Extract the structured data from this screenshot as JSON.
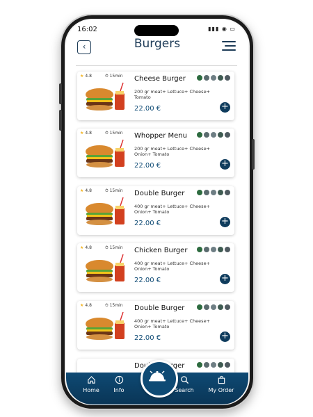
{
  "status": {
    "time": "16:02",
    "icons": "▮▮▮ ◉ ▭"
  },
  "header": {
    "back_icon": "back-arrow-icon",
    "back_glyph": "‹",
    "title": "Burgers",
    "menu_icon": "hamburger-menu-icon"
  },
  "items": [
    {
      "rating": "4.8",
      "time": "15min",
      "name": "Cheese Burger",
      "description": "200 gr meat+ Lettuce+ Cheese+ Tomato",
      "price": "22.00 €"
    },
    {
      "rating": "4.8",
      "time": "15min",
      "name": "Whopper Menu",
      "description": "200 gr meat+ Lettuce+ Cheese+ Onion+ Tomato",
      "price": "22.00 €"
    },
    {
      "rating": "4.8",
      "time": "15min",
      "name": "Double Burger",
      "description": "400 gr meat+ Lettuce+ Cheese+ Onion+ Tomato",
      "price": "22.00 €"
    },
    {
      "rating": "4.8",
      "time": "15min",
      "name": "Chicken Burger",
      "description": "400 gr meat+ Lettuce+ Cheese+ Onion+ Tomato",
      "price": "22.00 €"
    },
    {
      "rating": "4.8",
      "time": "15min",
      "name": "Double Burger",
      "description": "400 gr meat+ Lettuce+ Cheese+ Onion+ Tomato",
      "price": "22.00 €"
    },
    {
      "rating": "",
      "time": "",
      "name": "Double Burger",
      "description": "",
      "price": ""
    }
  ],
  "nav": {
    "home": {
      "label": "Home",
      "icon": "home-icon"
    },
    "info": {
      "label": "Info",
      "icon": "info-icon"
    },
    "center": {
      "icon": "service-bell-icon"
    },
    "search": {
      "label": "Search",
      "icon": "search-icon"
    },
    "order": {
      "label": "My Order",
      "icon": "shopping-bag-icon"
    }
  },
  "colors": {
    "primary": "#0e4a74",
    "title": "#1d3b57",
    "star": "#f3b21b"
  }
}
